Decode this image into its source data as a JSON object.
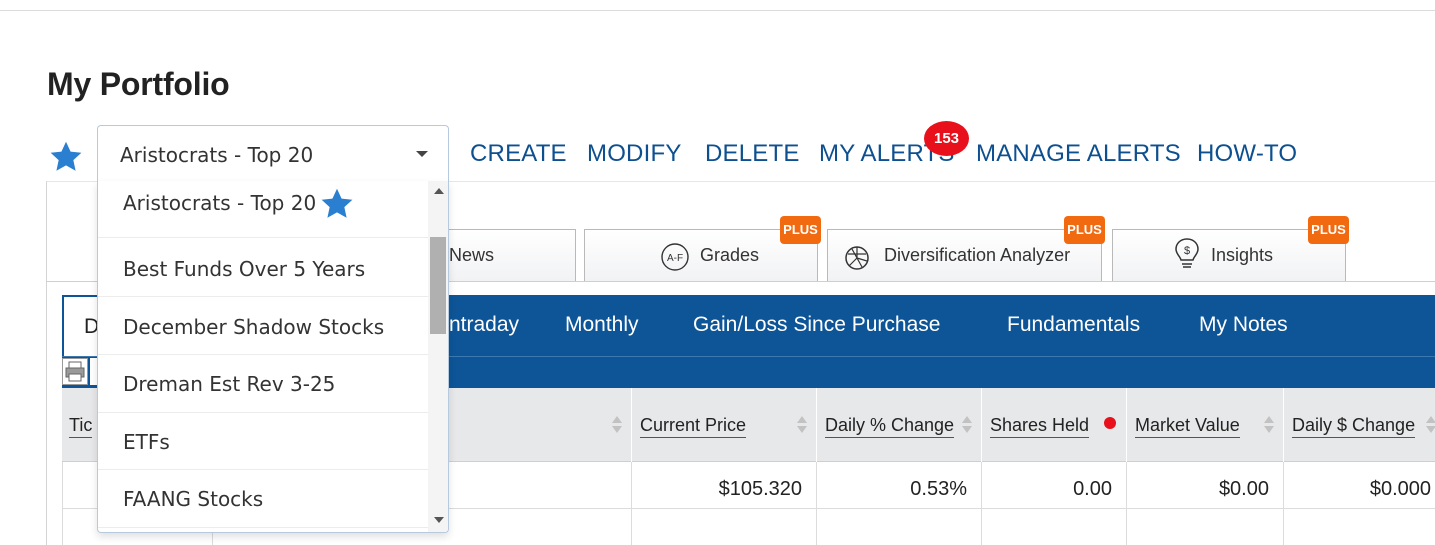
{
  "page": {
    "title": "My Portfolio"
  },
  "portfolio_select": {
    "selected": "Aristocrats - Top 20"
  },
  "actions": {
    "create": "CREATE",
    "modify": "MODIFY",
    "delete": "DELETE",
    "my_alerts": "MY ALERTS",
    "alerts_count": "153",
    "manage_alerts": "MANAGE ALERTS",
    "how_to": "HOW-TO"
  },
  "feature_tabs": {
    "news": "News",
    "grades": "Grades",
    "grades_icon_text": "A-F",
    "diversification": "Diversification Analyzer",
    "insights": "Insights",
    "plus_badge": "PLUS"
  },
  "view_tabs": {
    "first_partial": "D",
    "intraday_partial": "ntraday",
    "monthly": "Monthly",
    "gain_loss": "Gain/Loss Since Purchase",
    "fundamentals": "Fundamentals",
    "my_notes": "My Notes"
  },
  "table": {
    "headers": {
      "ticker_partial": "Tic",
      "current_price": "Current Price",
      "daily_pct_change": "Daily % Change",
      "shares_held": "Shares Held",
      "market_value": "Market Value",
      "daily_dollar_change": "Daily $ Change"
    },
    "rows": [
      {
        "current_price": "$105.320",
        "daily_pct_change": "0.53%",
        "shares_held": "0.00",
        "market_value": "$0.00",
        "daily_dollar_change": "$0.000"
      }
    ]
  },
  "dropdown": {
    "options": [
      "Aristocrats - Top 20",
      "Best Funds Over 5 Years",
      "December Shadow Stocks",
      "Dreman Est Rev 3-25",
      "ETFs",
      "FAANG Stocks"
    ],
    "favorite_index": 0
  },
  "colors": {
    "brand_blue": "#0d5597",
    "link_blue": "#0d4f8f",
    "star_blue": "#2b7fd0",
    "alert_red": "#e8111b",
    "plus_orange": "#f26a0f"
  },
  "icons": {
    "favorite": "star-icon",
    "dropdown": "caret-down-icon",
    "grades": "grades-icon",
    "diversification": "pie-chart-icon",
    "insights": "lightbulb-dollar-icon",
    "print": "print-icon",
    "sort": "sort-icon"
  }
}
